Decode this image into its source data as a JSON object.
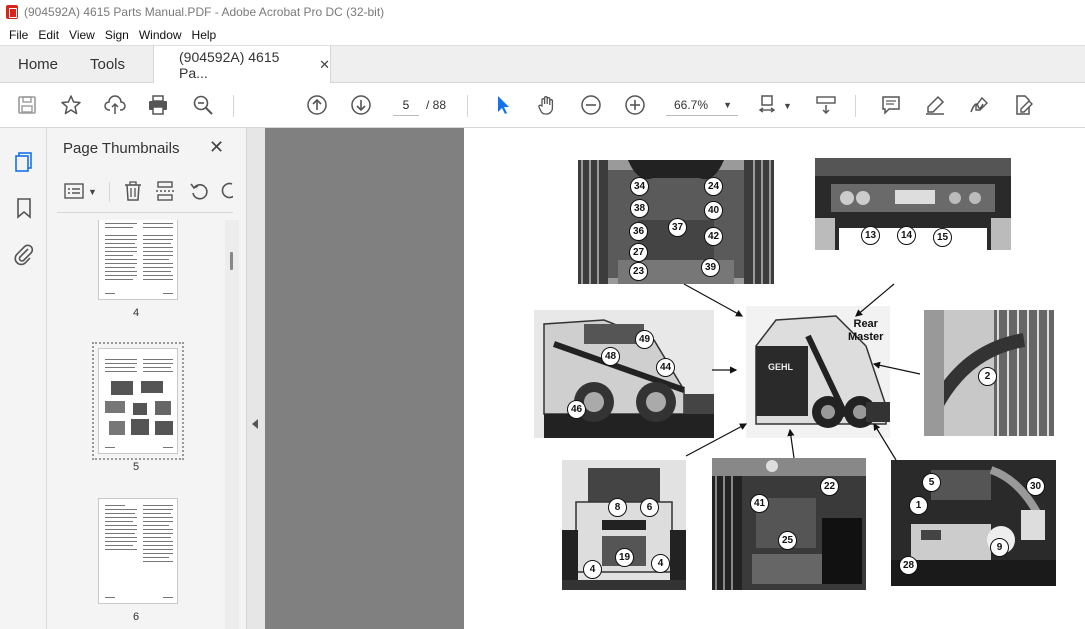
{
  "window": {
    "title": "(904592A) 4615 Parts Manual.PDF - Adobe Acrobat Pro DC (32-bit)"
  },
  "menu": {
    "items": [
      "File",
      "Edit",
      "View",
      "Sign",
      "Window",
      "Help"
    ]
  },
  "tabs": {
    "home": "Home",
    "tools": "Tools",
    "document": "(904592A) 4615 Pa...",
    "close": "✕"
  },
  "toolbar": {
    "page_current": "5",
    "page_total": "/ 88",
    "zoom": "66.7%",
    "accent": "#1473e6",
    "icons": [
      "save-icon",
      "bookmark-star-icon",
      "upload-cloud-icon",
      "print-icon",
      "search-zoom-icon",
      "page-up-icon",
      "page-down-icon",
      "select-arrow-icon",
      "hand-icon",
      "zoom-out-icon",
      "zoom-in-icon",
      "fit-page-icon",
      "scroll-mode-icon",
      "comment-icon",
      "highlight-icon",
      "sign-icon",
      "edit-pdf-icon"
    ]
  },
  "panel": {
    "title": "Page Thumbnails",
    "close": "✕",
    "thumbnails": [
      {
        "label": "4"
      },
      {
        "label": "5",
        "selected": true
      },
      {
        "label": "6"
      }
    ]
  },
  "document": {
    "labels": {
      "rear_master_line1": "Rear",
      "rear_master_line2": "Master"
    },
    "callouts": {
      "topleft": [
        "34",
        "24",
        "38",
        "40",
        "36",
        "37",
        "42",
        "27",
        "23",
        "39"
      ],
      "topright": [
        "13",
        "14",
        "15"
      ],
      "midleft": [
        "49",
        "48",
        "44",
        "46"
      ],
      "midright": [
        "2"
      ],
      "botleft": [
        "8",
        "6",
        "19",
        "4",
        "4"
      ],
      "botmid": [
        "41",
        "22",
        "25"
      ],
      "botright": [
        "5",
        "1",
        "30",
        "9",
        "28"
      ]
    }
  }
}
